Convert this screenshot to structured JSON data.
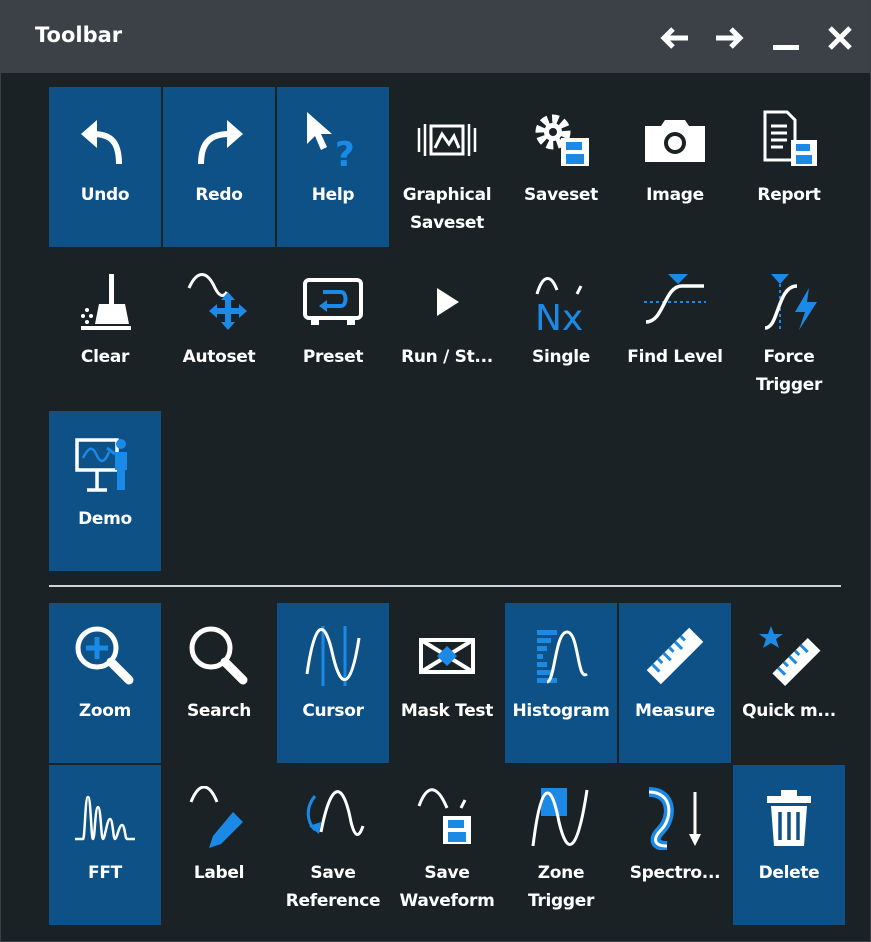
{
  "window": {
    "title": "Toolbar"
  },
  "titlebar_controls": {
    "back": "back-arrow-icon",
    "forward": "forward-arrow-icon",
    "minimize": "minimize-icon",
    "close": "close-icon"
  },
  "colors": {
    "active_tile": "#0d5186",
    "accent_icon": "#1a8ae6",
    "background": "#1b2226",
    "titlebar": "#3b4147"
  },
  "toolbar_top": [
    {
      "label": "Undo",
      "icon": "undo-icon",
      "active": true
    },
    {
      "label": "Redo",
      "icon": "redo-icon",
      "active": true
    },
    {
      "label": "Help",
      "icon": "help-icon",
      "active": true
    },
    {
      "label": "Graphical\nSaveset",
      "icon": "graphical-saveset-icon",
      "active": false
    },
    {
      "label": "Saveset",
      "icon": "saveset-icon",
      "active": false
    },
    {
      "label": "Image",
      "icon": "camera-icon",
      "active": false
    },
    {
      "label": "Report",
      "icon": "report-icon",
      "active": false
    },
    {
      "label": "Clear",
      "icon": "clear-broom-icon",
      "active": false
    },
    {
      "label": "Autoset",
      "icon": "autoset-icon",
      "active": false
    },
    {
      "label": "Preset",
      "icon": "preset-icon",
      "active": false
    },
    {
      "label": "Run / St...",
      "icon": "play-icon",
      "active": false
    },
    {
      "label": "Single",
      "icon": "single-nx-icon",
      "active": false
    },
    {
      "label": "Find Level",
      "icon": "find-level-icon",
      "active": false
    },
    {
      "label": "Force\nTrigger",
      "icon": "force-trigger-icon",
      "active": false
    },
    {
      "label": "Demo",
      "icon": "demo-icon",
      "active": true
    }
  ],
  "toolbar_bottom": [
    {
      "label": "Zoom",
      "icon": "zoom-icon",
      "active": true
    },
    {
      "label": "Search",
      "icon": "search-icon",
      "active": false
    },
    {
      "label": "Cursor",
      "icon": "cursor-icon",
      "active": true
    },
    {
      "label": "Mask Test",
      "icon": "mask-test-icon",
      "active": false
    },
    {
      "label": "Histogram",
      "icon": "histogram-icon",
      "active": true
    },
    {
      "label": "Measure",
      "icon": "measure-ruler-icon",
      "active": true
    },
    {
      "label": "Quick m...",
      "icon": "quick-measure-icon",
      "active": false
    },
    {
      "label": "FFT",
      "icon": "fft-icon",
      "active": true
    },
    {
      "label": "Label",
      "icon": "label-pen-icon",
      "active": false
    },
    {
      "label": "Save\nReference",
      "icon": "save-reference-icon",
      "active": false
    },
    {
      "label": "Save\nWaveform",
      "icon": "save-waveform-icon",
      "active": false
    },
    {
      "label": "Zone\nTrigger",
      "icon": "zone-trigger-icon",
      "active": false
    },
    {
      "label": "Spectro...",
      "icon": "spectrogram-icon",
      "active": false
    },
    {
      "label": "Delete",
      "icon": "trash-icon",
      "active": true
    }
  ]
}
